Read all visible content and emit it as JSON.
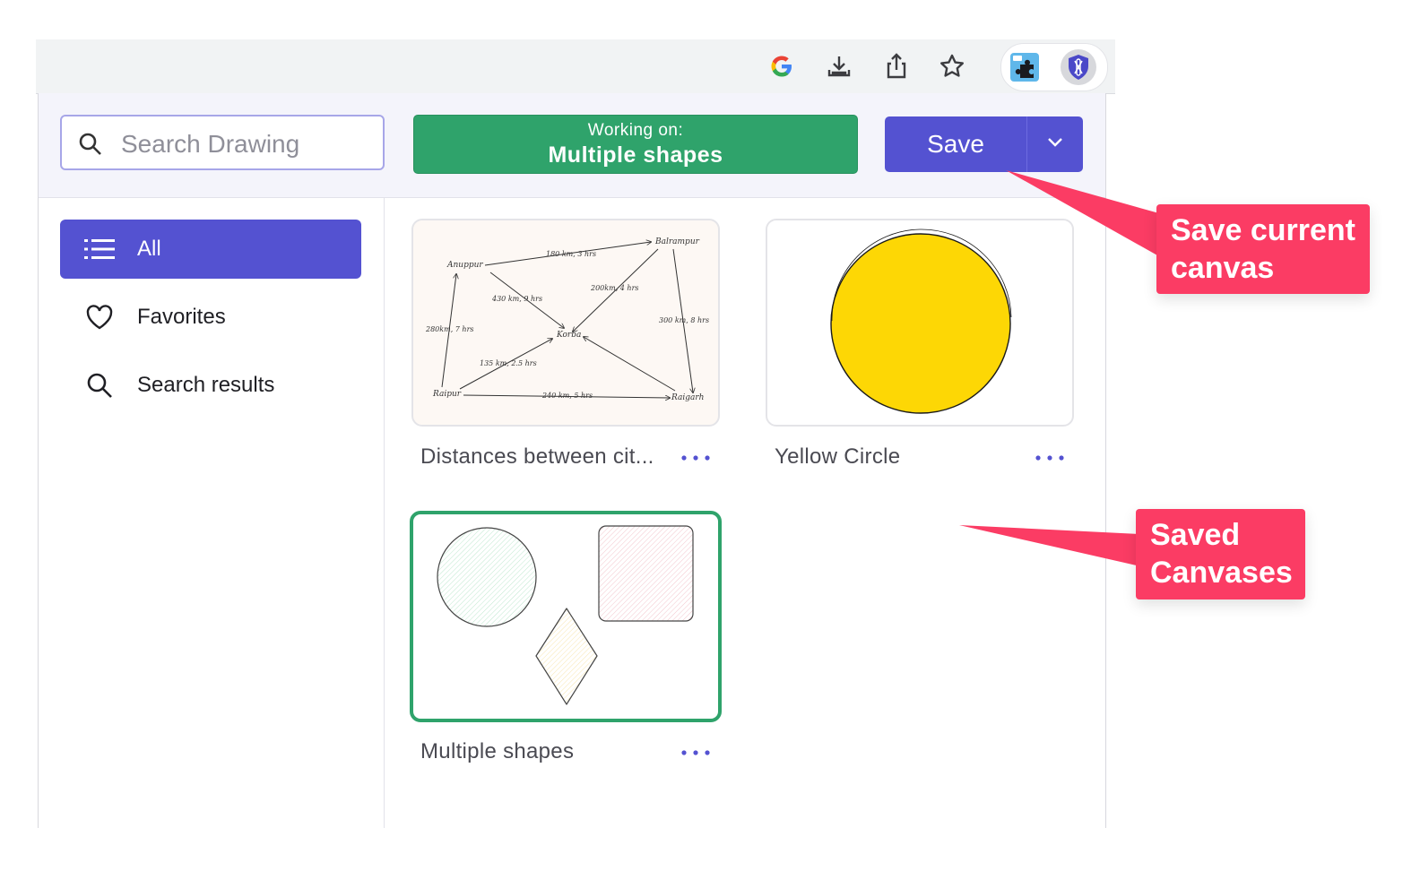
{
  "browser": {
    "toolbar_icons": [
      "google-icon",
      "install-icon",
      "share-icon",
      "bookmark-star-icon"
    ],
    "extension_icons": [
      "puzzle-extension-icon",
      "shield-extension-icon"
    ]
  },
  "header": {
    "search_placeholder": "Search Drawing",
    "working_on_label": "Working on:",
    "working_on_value": "Multiple shapes",
    "save_label": "Save"
  },
  "sidebar": {
    "items": [
      {
        "label": "All",
        "icon": "list-icon",
        "active": true
      },
      {
        "label": "Favorites",
        "icon": "heart-icon",
        "active": false
      },
      {
        "label": "Search results",
        "icon": "search-icon",
        "active": false
      }
    ]
  },
  "drawings": [
    {
      "title": "Distances between cit...",
      "thumbnail": {
        "cities": [
          "Anuppur",
          "Balrampur",
          "Korba",
          "Raipur",
          "Raigarh"
        ],
        "edges": [
          "180 km, 3 hrs",
          "200km, 4 hrs",
          "430 km, 9 hrs",
          "300 km, 8 hrs",
          "280km, 7 hrs",
          "135 km, 2.5 hrs",
          "240 km, 5 hrs"
        ]
      }
    },
    {
      "title": "Yellow Circle"
    },
    {
      "title": "Multiple shapes",
      "selected": true
    }
  ],
  "callouts": {
    "save": [
      "Save current",
      "canvas"
    ],
    "saved": [
      "Saved",
      "Canvases"
    ]
  },
  "colors": {
    "accent": "#5452d1",
    "working": "#2fa36b",
    "callout": "#fb3c64",
    "yellow": "#fdd705"
  }
}
